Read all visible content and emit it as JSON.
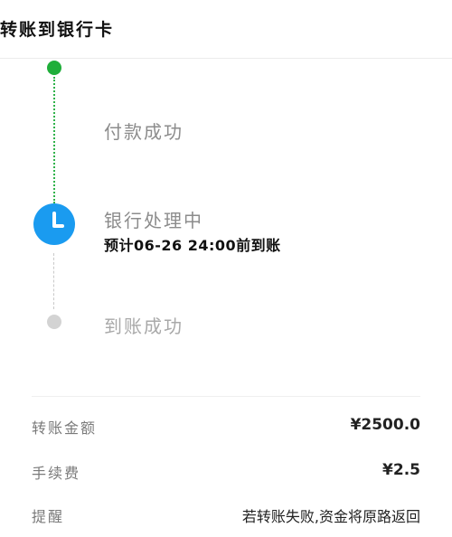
{
  "header": {
    "title": "转账到银行卡"
  },
  "timeline": {
    "steps": [
      {
        "label": "付款成功",
        "status": "done",
        "color": "#1fae3a"
      },
      {
        "label": "银行处理中",
        "sub": "预计06-26 24:00前到账",
        "status": "processing",
        "color": "#1a9bf0",
        "icon": "clock-icon"
      },
      {
        "label": "到账成功",
        "status": "pending",
        "color": "#d3d3d3"
      }
    ]
  },
  "details": {
    "amount_label": "转账金额",
    "amount_value": "¥2500.0",
    "fee_label": "手续费",
    "fee_value": "¥2.5",
    "reminder_label": "提醒",
    "reminder_value": "若转账失败,资金将原路返回"
  }
}
